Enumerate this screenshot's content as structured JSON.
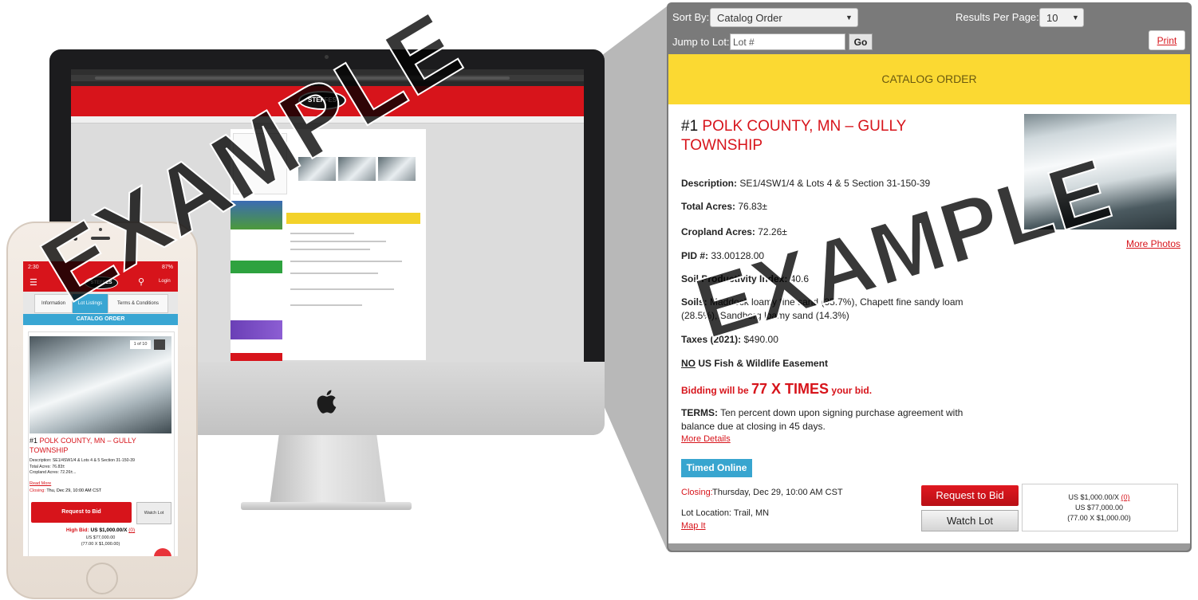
{
  "zoom_panel": {
    "sort_by_label": "Sort By:",
    "sort_by_value": "Catalog Order",
    "results_per_page_label": "Results Per Page:",
    "results_per_page_value": "10",
    "jump_to_lot_label": "Jump to Lot:",
    "jump_to_lot_placeholder": "Lot #",
    "go_label": "Go",
    "print_label": "Print",
    "section_banner": "CATALOG ORDER",
    "lot": {
      "number": "#1",
      "title": "POLK COUNTY, MN – GULLY TOWNSHIP",
      "more_photos": "More Photos",
      "description_label": "Description:",
      "description_value": "SE1/4SW1/4 & Lots 4 & 5 Section 31-150-39",
      "total_acres_label": "Total Acres:",
      "total_acres_value": "76.83±",
      "cropland_acres_label": "Cropland Acres:",
      "cropland_acres_value": "72.26±",
      "pid_label": "PID #:",
      "pid_value": "33.00128.00",
      "soil_index_label": "Soil Productivity Index:",
      "soil_index_value": "40.6",
      "soils_label": "Soils:",
      "soils_value": "Maddock loamy fine sand (35.7%), Chapett fine sandy loam (28.5%), Sandberg loamy sand (14.3%)",
      "taxes_label": "Taxes (2021):",
      "taxes_value": "$490.00",
      "easement_no": "NO",
      "easement_rest": "US Fish & Wildlife Easement",
      "bidding_prefix": "Bidding will be",
      "bidding_multiplier": "77 X TIMES",
      "bidding_suffix": "your bid.",
      "terms_label": "TERMS:",
      "terms_value": "Ten percent down upon signing purchase agreement with balance due at closing in 45 days.",
      "more_details": "More Details",
      "badge": "Timed Online",
      "closing_label": "Closing:",
      "closing_value": "Thursday, Dec 29, 10:00 AM CST",
      "lot_location": "Lot Location: Trail, MN",
      "map_it": "Map It",
      "request_to_bid": "Request to Bid",
      "watch_lot": "Watch Lot",
      "bid_line1": "US $1,000.00/X",
      "bid_line1_link": "(0)",
      "bid_line2": "US $77,000.00",
      "bid_line3": "(77.00 X $1,000.00)"
    }
  },
  "desktop_mock": {
    "logo": "STEFFES"
  },
  "phone_mock": {
    "status_time": "2:30",
    "status_right": "87%",
    "logo": "STEFFES",
    "login": "Login",
    "tabs": [
      "Information",
      "Lot Listings",
      "Terms & Conditions"
    ],
    "banner": "CATALOG ORDER",
    "photo_counter": "1 of 10",
    "lot_number": "#1",
    "lot_title": "POLK COUNTY, MN – GULLY TOWNSHIP",
    "description": "Description: SE1/4SW1/4 & Lots 4 & 5 Section 31-150-39",
    "total_acres": "Total Acres: 76.83±",
    "cropland": "Cropland Acres: 72.26±...",
    "read_more": "Read More",
    "closing_label": "Closing:",
    "closing_value": "Thu, Dec 29, 10:00 AM CST",
    "request_to_bid": "Request to Bid",
    "watch_lot": "Watch Lot",
    "high_bid_label": "High Bid:",
    "high_bid_value": "US $1,000.00/X",
    "high_bid_link": "(0)",
    "high_bid_line2": "US $77,000.00",
    "high_bid_line3": "(77.00 X $1,000.00)"
  },
  "watermark_text": "EXAMPLE",
  "colors": {
    "brand_red": "#d7141b",
    "banner_yellow": "#fbd932",
    "badge_blue": "#38a5cf",
    "panel_gray": "#7a7a7a"
  }
}
